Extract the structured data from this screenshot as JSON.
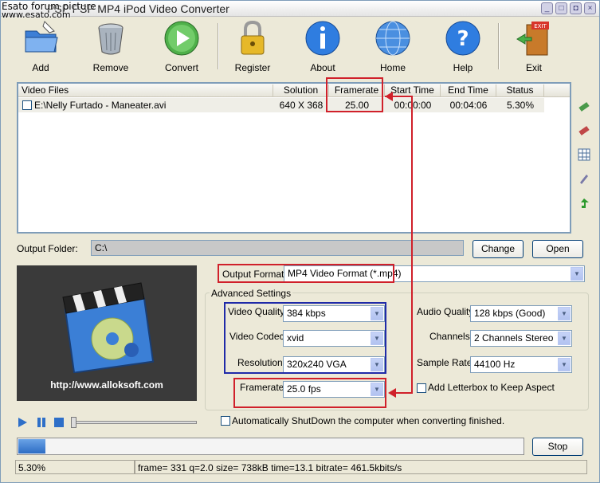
{
  "window": {
    "title": "PSP PSP MP4 iPod Video Converter",
    "watermark_line1": "Esato forum picture",
    "watermark_line2": "www.esato.com"
  },
  "toolbar": {
    "items": [
      {
        "label": "Add",
        "icon": "add-folder-icon"
      },
      {
        "label": "Remove",
        "icon": "trash-can-icon"
      },
      {
        "label": "Convert",
        "icon": "play-icon"
      },
      {
        "label": "Register",
        "icon": "padlock-icon"
      },
      {
        "label": "About",
        "icon": "info-icon"
      },
      {
        "label": "Home",
        "icon": "globe-icon"
      },
      {
        "label": "Help",
        "icon": "help-icon"
      },
      {
        "label": "Exit",
        "icon": "exit-door-icon"
      }
    ]
  },
  "file_list": {
    "columns": [
      "Video Files",
      "Solution",
      "Framerate",
      "Start Time",
      "End Time",
      "Status"
    ],
    "rows": [
      {
        "file": "E:\\Nelly Furtado - Maneater.avi",
        "solution": "640 X 368",
        "framerate": "25.00",
        "start": "00:00:00",
        "end": "00:04:06",
        "status": "5.30%"
      }
    ]
  },
  "output_folder": {
    "label": "Output Folder:",
    "value": "C:\\",
    "change": "Change",
    "open": "Open"
  },
  "preview": {
    "url": "http://www.alloksoft.com"
  },
  "output_format": {
    "label": "Output Format:",
    "value": "MP4 Video Format (*.mp4)"
  },
  "advanced": {
    "title": "Advanced Settings",
    "video_quality_label": "Video Quality:",
    "video_quality": "384  kbps",
    "video_codec_label": "Video Codec:",
    "video_codec": "xvid",
    "resolution_label": "Resolution:",
    "resolution": "320x240 VGA",
    "framerate_label": "Framerate:",
    "framerate": "25.0   fps",
    "audio_quality_label": "Audio Quality:",
    "audio_quality": "128 kbps (Good)",
    "channels_label": "Channels:",
    "channels": "2 Channels Stereo",
    "sample_rate_label": "Sample Rate:",
    "sample_rate": "44100 Hz",
    "letterbox_label": "Add Letterbox to Keep Aspect"
  },
  "shutdown_label": "Automatically ShutDown the computer when converting finished.",
  "progress": {
    "fraction": 0.053,
    "stop": "Stop"
  },
  "status_bar": {
    "percent": "5.30%",
    "detail": "frame=  331  q=2.0 size=      738kB time=13.1 bitrate= 461.5kbits/s"
  },
  "colors": {
    "highlight_red": "#d0202a",
    "highlight_blue": "#1f2aa8",
    "progress_blue": "#2d6cc3"
  }
}
